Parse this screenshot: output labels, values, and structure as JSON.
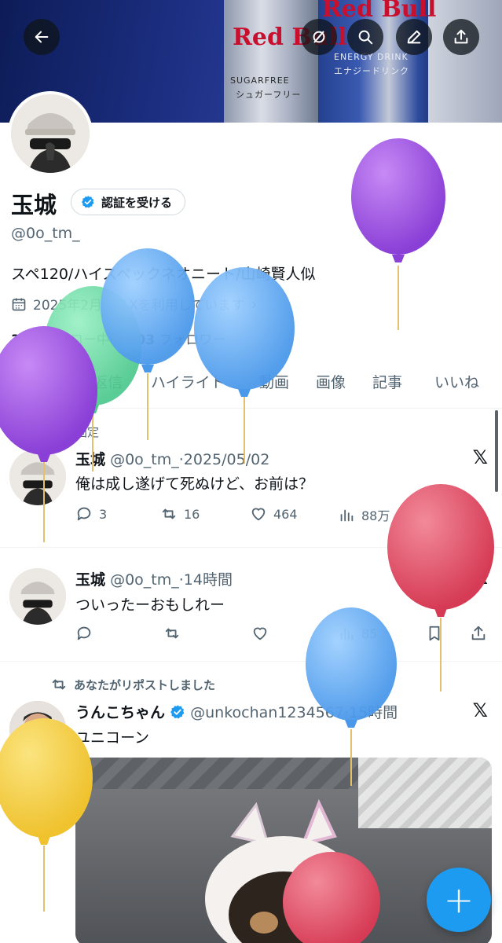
{
  "header": {
    "back_icon": "back-arrow-icon",
    "actions": [
      "no-circle-icon",
      "search-icon",
      "edit-icon",
      "share-icon"
    ],
    "banner_text": [
      "Red Bull",
      "SUGARFREE",
      "シュガーフリー",
      "ENERGY DRINK",
      "エナジードリンク"
    ]
  },
  "profile": {
    "name": "玉城",
    "verify_label": "認証を受ける",
    "handle": "@0o_tm_",
    "bio": "スペ120/ハイスペックネオニート/山崎賢人似",
    "joined": "2025年2月からXを利用しています",
    "following_count": "334",
    "following_label": "フォロー中",
    "followers_count": "403",
    "followers_label": "フォロワー"
  },
  "tabs": [
    "ポスト",
    "返信",
    "ハイライト",
    "動画",
    "画像",
    "記事",
    "いいね"
  ],
  "posts": [
    {
      "pinned_label": "固定",
      "name": "玉城",
      "meta": "@0o_tm_·2025/05/02",
      "text": "俺は成し遂げて死ぬけど、お前は？",
      "replies": "3",
      "reposts": "16",
      "likes": "464",
      "views": "88万"
    },
    {
      "name": "玉城",
      "meta": "@0o_tm_·14時間",
      "text": "ついったーおもしれー",
      "views": "85"
    },
    {
      "repost_label": "あなたがリポストしました",
      "name": "うんこちゃん",
      "meta": "@unkochan1234567·15時間",
      "text": "ユニコーン"
    }
  ],
  "fab_label": "+",
  "colors": {
    "accent": "#1d9bf0",
    "text_secondary": "#536471",
    "balloon_purple": "#9b4fe0",
    "balloon_green": "#5ad69a",
    "balloon_blue": "#5aa8f0",
    "balloon_red": "#e0485f",
    "balloon_yellow": "#f4cf42"
  }
}
